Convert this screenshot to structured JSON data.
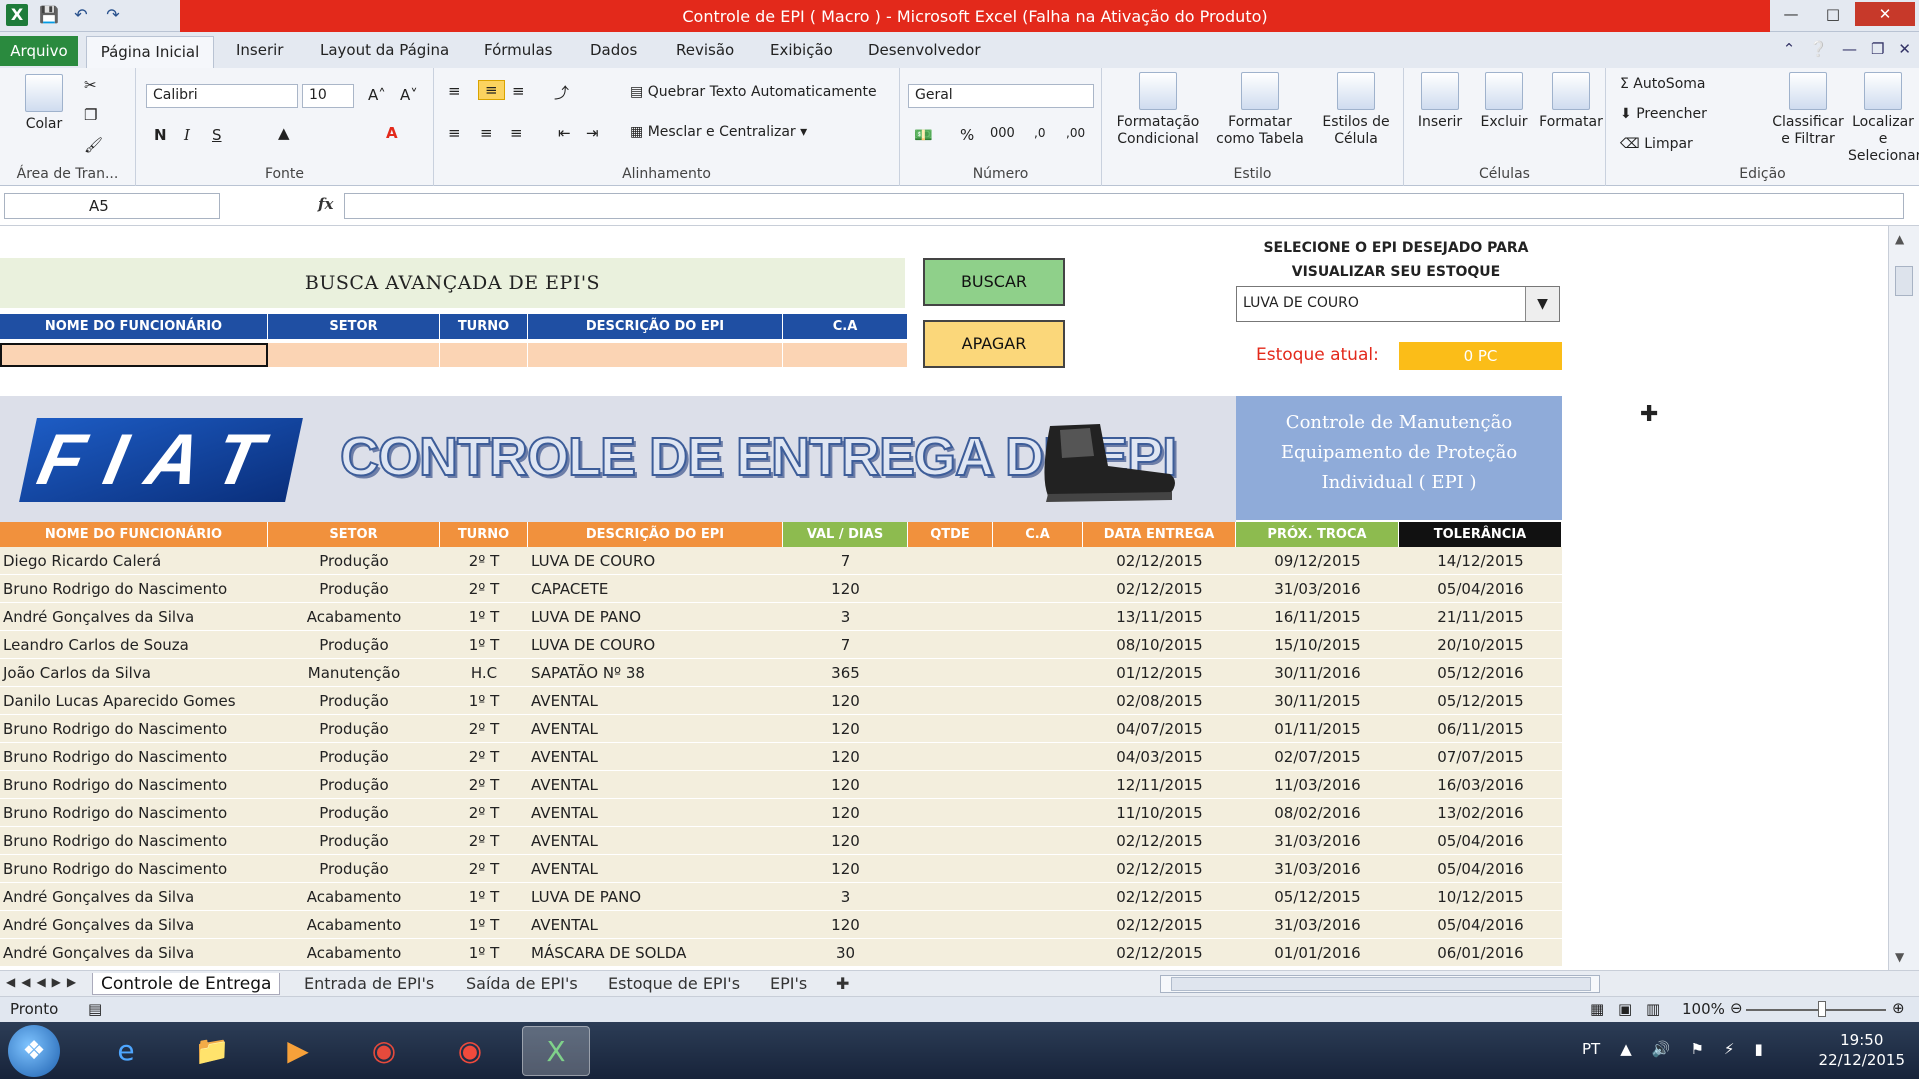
{
  "window": {
    "title": "Controle de EPI ( Macro ) - Microsoft Excel (Falha na Ativação do Produto)"
  },
  "ribbon_tabs": {
    "file": "Arquivo",
    "active": "Página Inicial",
    "items": [
      "Inserir",
      "Layout da Página",
      "Fórmulas",
      "Dados",
      "Revisão",
      "Exibição",
      "Desenvolvedor"
    ]
  },
  "ribbon": {
    "clipboard": {
      "paste": "Colar",
      "label": "Área de Tran..."
    },
    "font": {
      "name": "Calibri",
      "size": "10",
      "bold": "N",
      "italic": "I",
      "underline": "S",
      "label": "Fonte"
    },
    "alignment": {
      "wrap": "Quebrar Texto Automaticamente",
      "merge": "Mesclar e Centralizar",
      "label": "Alinhamento"
    },
    "number": {
      "format": "Geral",
      "label": "Número"
    },
    "styles": {
      "cond": "Formatação Condicional",
      "table": "Formatar como Tabela",
      "cell": "Estilos de Célula",
      "label": "Estilo"
    },
    "cells": {
      "insert": "Inserir",
      "delete": "Excluir",
      "format": "Formatar",
      "label": "Células"
    },
    "edit": {
      "autosum": "AutoSoma",
      "fill": "Preencher",
      "clear": "Limpar",
      "sort": "Classificar e Filtrar",
      "find": "Localizar e Selecionar",
      "label": "Edição"
    }
  },
  "formula_bar": {
    "name_box": "A5",
    "fx": "fx"
  },
  "search": {
    "title": "BUSCA AVANÇADA DE EPI'S",
    "headers": [
      "NOME DO FUNCIONÁRIO",
      "SETOR",
      "TURNO",
      "DESCRIÇÃO DO EPI",
      "C.A"
    ],
    "buscar": "BUSCAR",
    "apagar": "APAGAR"
  },
  "stock": {
    "title": "SELECIONE O EPI DESEJADO PARA VISUALIZAR SEU ESTOQUE",
    "selected": "LUVA DE COURO",
    "label": "Estoque atual:",
    "value": "0 PC"
  },
  "banner": {
    "logo": "FIAT",
    "title": "CONTROLE DE ENTREGA DE EPI",
    "side": "Controle de Manutenção Equipamento de Proteção Individual ( EPI )"
  },
  "table": {
    "headers": [
      "NOME DO FUNCIONÁRIO",
      "SETOR",
      "TURNO",
      "DESCRIÇÃO DO EPI",
      "VAL / DIAS",
      "QTDE",
      "C.A",
      "DATA ENTREGA",
      "PRÓX. TROCA",
      "TOLERÂNCIA"
    ],
    "rows": [
      [
        "Diego Ricardo Calerá",
        "Produção",
        "2º T",
        "LUVA DE COURO",
        "7",
        "",
        "",
        "02/12/2015",
        "09/12/2015",
        "14/12/2015"
      ],
      [
        "Bruno Rodrigo do Nascimento",
        "Produção",
        "2º T",
        "CAPACETE",
        "120",
        "",
        "",
        "02/12/2015",
        "31/03/2016",
        "05/04/2016"
      ],
      [
        "André Gonçalves da Silva",
        "Acabamento",
        "1º T",
        "LUVA DE PANO",
        "3",
        "",
        "",
        "13/11/2015",
        "16/11/2015",
        "21/11/2015"
      ],
      [
        "Leandro Carlos de Souza",
        "Produção",
        "1º T",
        "LUVA DE COURO",
        "7",
        "",
        "",
        "08/10/2015",
        "15/10/2015",
        "20/10/2015"
      ],
      [
        "João Carlos da Silva",
        "Manutenção",
        "H.C",
        "SAPATÃO Nº 38",
        "365",
        "",
        "",
        "01/12/2015",
        "30/11/2016",
        "05/12/2016"
      ],
      [
        "Danilo Lucas Aparecido Gomes",
        "Produção",
        "1º T",
        "AVENTAL",
        "120",
        "",
        "",
        "02/08/2015",
        "30/11/2015",
        "05/12/2015"
      ],
      [
        "Bruno Rodrigo do Nascimento",
        "Produção",
        "2º T",
        "AVENTAL",
        "120",
        "",
        "",
        "04/07/2015",
        "01/11/2015",
        "06/11/2015"
      ],
      [
        "Bruno Rodrigo do Nascimento",
        "Produção",
        "2º T",
        "AVENTAL",
        "120",
        "",
        "",
        "04/03/2015",
        "02/07/2015",
        "07/07/2015"
      ],
      [
        "Bruno Rodrigo do Nascimento",
        "Produção",
        "2º T",
        "AVENTAL",
        "120",
        "",
        "",
        "12/11/2015",
        "11/03/2016",
        "16/03/2016"
      ],
      [
        "Bruno Rodrigo do Nascimento",
        "Produção",
        "2º T",
        "AVENTAL",
        "120",
        "",
        "",
        "11/10/2015",
        "08/02/2016",
        "13/02/2016"
      ],
      [
        "Bruno Rodrigo do Nascimento",
        "Produção",
        "2º T",
        "AVENTAL",
        "120",
        "",
        "",
        "02/12/2015",
        "31/03/2016",
        "05/04/2016"
      ],
      [
        "Bruno Rodrigo do Nascimento",
        "Produção",
        "2º T",
        "AVENTAL",
        "120",
        "",
        "",
        "02/12/2015",
        "31/03/2016",
        "05/04/2016"
      ],
      [
        "André Gonçalves da Silva",
        "Acabamento",
        "1º T",
        "LUVA DE PANO",
        "3",
        "",
        "",
        "02/12/2015",
        "05/12/2015",
        "10/12/2015"
      ],
      [
        "André Gonçalves da Silva",
        "Acabamento",
        "1º T",
        "AVENTAL",
        "120",
        "",
        "",
        "02/12/2015",
        "31/03/2016",
        "05/04/2016"
      ],
      [
        "André Gonçalves da Silva",
        "Acabamento",
        "1º T",
        "MÁSCARA DE SOLDA",
        "30",
        "",
        "",
        "02/12/2015",
        "01/01/2016",
        "06/01/2016"
      ]
    ]
  },
  "sheet_tabs": [
    "Controle de Entrega",
    "Entrada de EPI's",
    "Saída de EPI's",
    "Estoque de EPI's",
    "EPI's"
  ],
  "status": {
    "ready": "Pronto",
    "zoom": "100%"
  },
  "taskbar": {
    "lang": "PT",
    "time": "19:50",
    "date": "22/12/2015"
  }
}
